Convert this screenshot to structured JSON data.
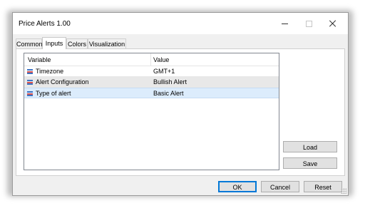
{
  "window": {
    "title": "Price Alerts 1.00",
    "controls": {
      "minimize": "minimize-icon",
      "maximize": "maximize-icon",
      "close": "close-icon"
    }
  },
  "tabs": [
    {
      "label": "Common",
      "active": false
    },
    {
      "label": "Inputs",
      "active": true
    },
    {
      "label": "Colors",
      "active": false
    },
    {
      "label": "Visualization",
      "active": false
    }
  ],
  "grid": {
    "columns": {
      "variable": "Variable",
      "value": "Value"
    },
    "rows": [
      {
        "variable": "Timezone",
        "value": "GMT+1",
        "icon": "input-variable-icon"
      },
      {
        "variable": "Alert Configuration",
        "value": "Bullish Alert",
        "icon": "input-variable-icon"
      },
      {
        "variable": "Type of alert",
        "value": "Basic Alert",
        "icon": "input-variable-icon",
        "selected": true
      }
    ]
  },
  "side_buttons": {
    "load": "Load",
    "save": "Save"
  },
  "footer_buttons": {
    "ok": "OK",
    "cancel": "Cancel",
    "reset": "Reset"
  },
  "colors": {
    "selection": "#dcecfc",
    "default_button_border": "#0078d7",
    "icon_blue": "#3b73c4",
    "icon_red": "#d9534f"
  }
}
